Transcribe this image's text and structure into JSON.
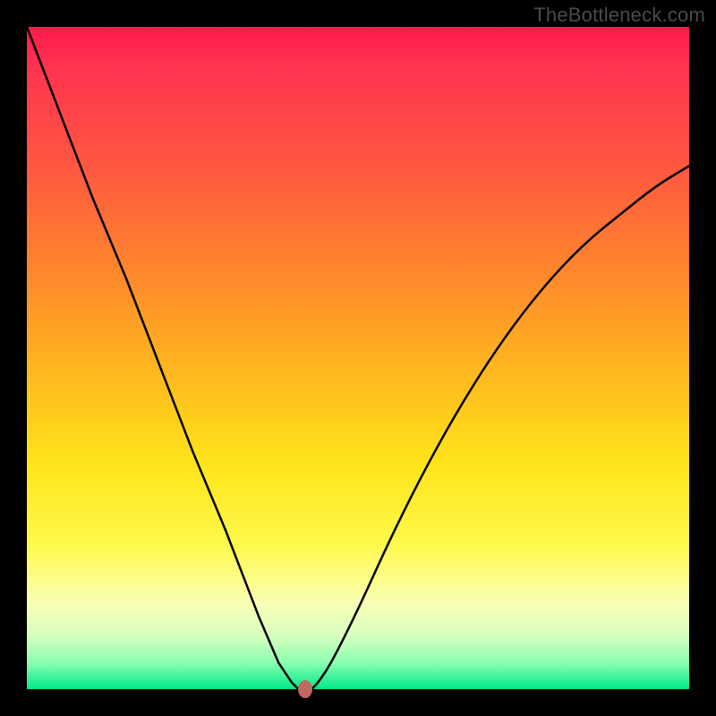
{
  "watermark": "TheBottleneck.com",
  "chart_data": {
    "type": "line",
    "title": "",
    "xlabel": "",
    "ylabel": "",
    "xlim": [
      0,
      100
    ],
    "ylim": [
      0,
      100
    ],
    "grid": false,
    "series": [
      {
        "name": "bottleneck-curve",
        "x": [
          0,
          5,
          10,
          15,
          20,
          25,
          30,
          35,
          38,
          40,
          41,
          42,
          43,
          44,
          46,
          50,
          55,
          60,
          65,
          70,
          75,
          80,
          85,
          90,
          95,
          100
        ],
        "y": [
          100,
          87,
          74,
          62,
          49,
          36,
          24,
          11,
          4,
          1,
          0,
          0,
          0,
          1,
          4,
          12,
          23,
          33,
          42,
          50,
          57,
          63,
          68,
          72,
          76,
          79
        ]
      }
    ],
    "marker": {
      "x": 42,
      "y": 0,
      "color": "#c06862"
    },
    "background_gradient": {
      "direction": "vertical",
      "stops": [
        {
          "pos": 0.0,
          "color": "#ff1a4d"
        },
        {
          "pos": 0.22,
          "color": "#ff5a3f"
        },
        {
          "pos": 0.52,
          "color": "#ffb71f"
        },
        {
          "pos": 0.78,
          "color": "#fff94a"
        },
        {
          "pos": 0.92,
          "color": "#d6ffbf"
        },
        {
          "pos": 1.0,
          "color": "#00e88a"
        }
      ]
    }
  }
}
